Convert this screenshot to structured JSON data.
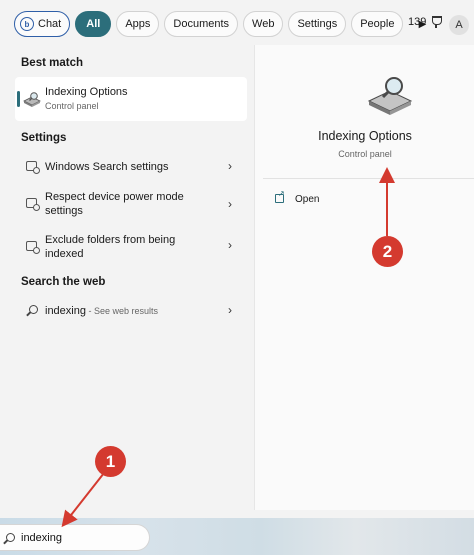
{
  "filters": {
    "chat": "Chat",
    "all": "All",
    "apps": "Apps",
    "documents": "Documents",
    "web": "Web",
    "settings": "Settings",
    "people": "People",
    "points": "139",
    "avatar_initial": "A"
  },
  "best_match": {
    "heading": "Best match",
    "title": "Indexing Options",
    "subtitle": "Control panel"
  },
  "settings": {
    "heading": "Settings",
    "items": [
      {
        "label": "Windows Search settings"
      },
      {
        "label": "Respect device power mode settings"
      },
      {
        "label": "Exclude folders from being indexed"
      }
    ]
  },
  "web": {
    "heading": "Search the web",
    "query": "indexing",
    "suffix": " - See web results"
  },
  "detail": {
    "title": "Indexing Options",
    "subtitle": "Control panel",
    "open_label": "Open"
  },
  "search": {
    "value": "indexing"
  },
  "annotations": {
    "step1": "1",
    "step2": "2"
  },
  "colors": {
    "accent": "#2c6e7b",
    "annotation": "#d43a2f",
    "chat_border": "#2f5fa8"
  }
}
